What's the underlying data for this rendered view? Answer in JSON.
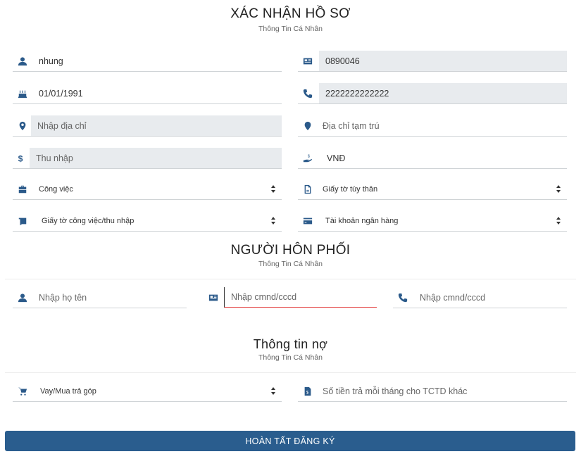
{
  "profile": {
    "title": "XÁC NHẬN HỒ SƠ",
    "subtitle": "Thông Tin Cá Nhân",
    "fields": {
      "name": "nhung",
      "id_number": "0890046",
      "birthday": "01/01/1991",
      "phone": "2222222222222",
      "address_placeholder": "Nhập địa chỉ",
      "temp_address_placeholder": "Địa chỉ tạm trú",
      "income_placeholder": "Thu nhập",
      "currency": "VNĐ",
      "job_select": "Công việc",
      "id_doc_select": "Giấy tờ tùy thân",
      "work_doc_select": "Giấy tờ công việc/thu nhập",
      "bank_select": "Tài khoản ngân hàng"
    }
  },
  "spouse": {
    "title": "NGƯỜI HÔN PHỐI",
    "subtitle": "Thông Tin Cá Nhân",
    "name_placeholder": "Nhập họ tên",
    "id_placeholder": "Nhập cmnd/cccd",
    "phone_placeholder": "Nhập cmnd/cccd"
  },
  "debt": {
    "title": "Thông tin nợ",
    "subtitle": "Thông Tin Cá Nhân",
    "loan_select": "Vay/Mua trả góp",
    "monthly_placeholder": "Số tiền trả mỗi tháng cho TCTD khác"
  },
  "submit_label": "HOÀN TẤT ĐĂNG KÝ",
  "colors": {
    "accent": "#2a5d8e",
    "focus": "#e34040",
    "field_bg": "#e8ebee"
  }
}
